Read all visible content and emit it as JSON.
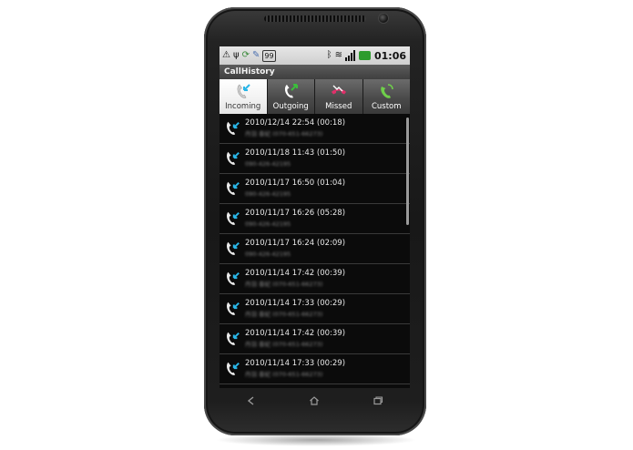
{
  "app": {
    "title": "CallHistory"
  },
  "status_bar": {
    "time": "01:06",
    "notification_count": "99",
    "battery_color": "#2e9b2e"
  },
  "tabs": [
    {
      "label": "Incoming",
      "icon": "incoming-call-icon",
      "active": true
    },
    {
      "label": "Outgoing",
      "icon": "outgoing-call-icon",
      "active": false
    },
    {
      "label": "Missed",
      "icon": "missed-call-icon",
      "active": false
    },
    {
      "label": "Custom",
      "icon": "custom-call-icon",
      "active": false
    }
  ],
  "calls": [
    {
      "datetime": "2010/12/14 22:54 (00:18)",
      "number": "丹羽 泰紀 (070-651-66273)"
    },
    {
      "datetime": "2010/11/18 11:43 (01:50)",
      "number": "090-426-42195"
    },
    {
      "datetime": "2010/11/17 16:50 (01:04)",
      "number": "090-426-42195"
    },
    {
      "datetime": "2010/11/17 16:26 (05:28)",
      "number": "090-426-42195"
    },
    {
      "datetime": "2010/11/17 16:24 (02:09)",
      "number": "090-426-42195"
    },
    {
      "datetime": "2010/11/14 17:42 (00:39)",
      "number": "丹羽 泰紀 (070-651-66273)"
    },
    {
      "datetime": "2010/11/14 17:33 (00:29)",
      "number": "丹羽 泰紀 (070-651-66273)"
    },
    {
      "datetime": "2010/11/14 17:42 (00:39)",
      "number": "丹羽 泰紀 (070-651-66273)"
    },
    {
      "datetime": "2010/11/14 17:33 (00:29)",
      "number": "丹羽 泰紀 (070-651-66273)"
    }
  ],
  "nav": {
    "back": "back-icon",
    "home": "home-icon",
    "recent": "recent-apps-icon"
  },
  "colors": {
    "incoming_arrow": "#29b6e8",
    "outgoing_arrow": "#3bbf3b",
    "missed_handset": "#e0306a",
    "custom_handset": "#6fd04a"
  }
}
